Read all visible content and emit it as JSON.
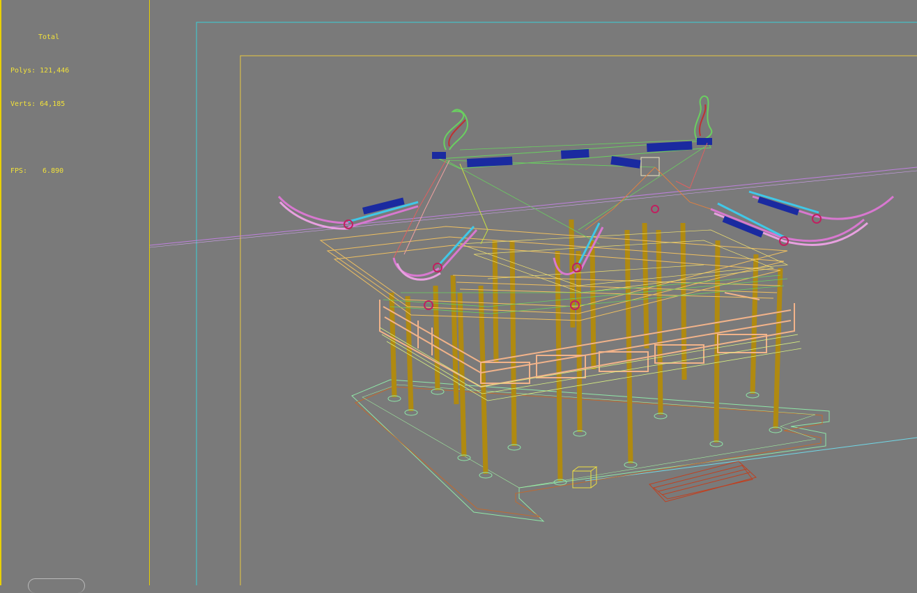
{
  "stats": {
    "header": "Total",
    "polys_label": "Polys:",
    "polys_value": "121,446",
    "verts_label": "Verts:",
    "verts_value": "64,185",
    "fps_label": "FPS:",
    "fps_value": "6.890"
  },
  "colors": {
    "background": "#7a7a7a",
    "stats_text": "#f2e23a",
    "safe_frame_outer": "#3ad0d8",
    "safe_frame_inner": "#e8c840",
    "columns": "#b08a10",
    "railing": "#f2b38a",
    "roof_blue": "#1a2aa0",
    "roof_pink": "#d878d0",
    "roof_cyan": "#40c8e8",
    "wire_green": "#6ad060"
  }
}
